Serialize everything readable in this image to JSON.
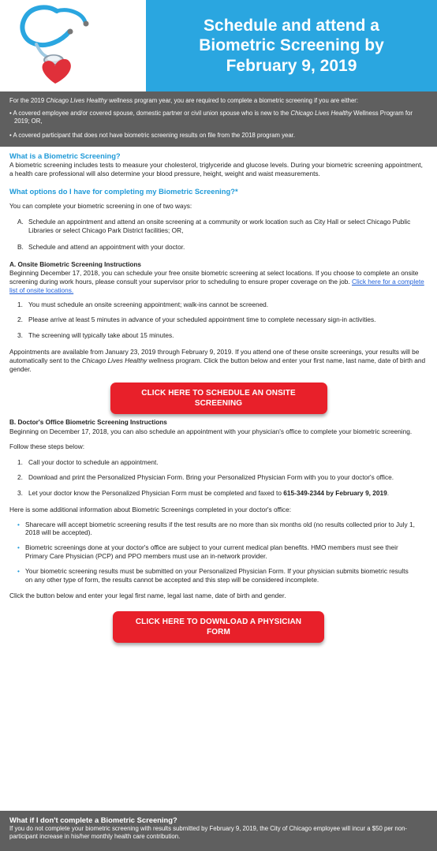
{
  "hero": {
    "title_lines": [
      "Schedule and attend a",
      "Biometric Screening by",
      "February 9, 2019"
    ],
    "art_icons": [
      "stethoscope-icon",
      "heart-icon"
    ],
    "colors": {
      "title_bg": "#2aa6e0",
      "stethoscope": "#2aa6e0",
      "heart": "#e0303a"
    }
  },
  "notice": {
    "intro_pre": "For the 2019 ",
    "intro_em": "Chicago Lives Healthy",
    "intro_post": " wellness program year, you are required to complete a biometric screening if you are either:",
    "bullet1_pre": "• A covered employee and/or covered spouse, domestic partner or civil union spouse who is new to the ",
    "bullet1_em": "Chicago Lives Healthy",
    "bullet1_post": " Wellness Program for 2019; OR,",
    "bullet2": "• A covered participant that does not have biometric screening results on file from the 2018 program year."
  },
  "what_is": {
    "heading": "What is a Biometric Screening?",
    "text": "A biometric screening includes tests to measure your cholesterol, triglyceride and glucose levels. During your biometric screening appointment, a health care professional will also determine your blood pressure, height, weight and waist measurements."
  },
  "options": {
    "heading": "What options do I have for completing my Biometric Screening?*",
    "intro": "You can complete your biometric screening in one of two ways:",
    "a_label": "A.",
    "a_text": "Schedule an appointment and attend an onsite screening at a community or work location such as City Hall or select Chicago Public Libraries or select Chicago Park District facilities; OR,",
    "b_label": "B.",
    "b_text": "Schedule and attend an appointment with your doctor."
  },
  "onsite": {
    "heading": "A. Onsite Biometric Screening Instructions",
    "intro": "Beginning December 17, 2018, you can schedule your free onsite biometric screening at select locations. If you choose to complete an onsite screening during work hours, please consult your supervisor prior to scheduling to ensure proper coverage on the job. ",
    "link": "Click here for a complete list of onsite locations.",
    "steps": [
      {
        "n": "1.",
        "t": "You must schedule an onsite screening appointment; walk-ins cannot be screened."
      },
      {
        "n": "2.",
        "t": "Please arrive at least 5 minutes in advance of your scheduled appointment time to complete necessary sign-in activities."
      },
      {
        "n": "3.",
        "t": "The screening will typically take about 15 minutes."
      }
    ],
    "appt_pre": "Appointments are available from January 23, 2019 through February 9, 2019. If you attend one of these onsite screenings, your results will be automatically sent to the ",
    "appt_em": "Chicago Lives Healthy",
    "appt_post": " wellness program. Click the button below and enter your first name, last name, date of birth and gender.",
    "button": "CLICK HERE TO SCHEDULE AN ONSITE SCREENING"
  },
  "doctor": {
    "heading": "B. Doctor's Office Biometric Screening Instructions",
    "intro": "Beginning on December 17, 2018, you can also schedule an appointment with your physician's office to complete your biometric screening.",
    "follow": "Follow these steps below:",
    "step1": "Call your doctor to schedule an appointment.",
    "step2": "Download and print the Personalized Physician Form. Bring your Personalized Physician Form with you to your doctor's office.",
    "step3_pre": "Let your doctor know the Personalized Physician Form must be completed and faxed to ",
    "step3_bold": "615-349-2344 by February 9, 2019",
    "step3_post": ".",
    "n1": "1.",
    "n2": "2.",
    "n3": "3.",
    "additional": "Here is some additional information about Biometric Screenings completed in your doctor's office:",
    "bullets": [
      "Sharecare will accept biometric screening results if the test results are no more than six months old (no results collected prior to July 1, 2018 will be accepted).",
      "Biometric screenings done at your doctor's office are subject to your current medical plan benefits. HMO members must see their Primary Care Physician (PCP) and PPO members must use an in-network provider.",
      "Your biometric screening results must be submitted on your Personalized Physician Form. If your physician submits biometric results on any other type of form, the results cannot be accepted and this step will be considered incomplete."
    ],
    "bullet_mark": "•",
    "click_text": "Click the button below and enter your legal first name, legal last name, date of birth and gender.",
    "button": "CLICK HERE TO DOWNLOAD A PHYSICIAN FORM"
  },
  "footer": {
    "heading": "What if I don't complete a Biometric Screening?",
    "text": "If you do not complete your biometric screening with results submitted by February 9, 2019, the City of Chicago employee will incur a $50 per non-participant increase in his/her monthly health care contribution."
  }
}
